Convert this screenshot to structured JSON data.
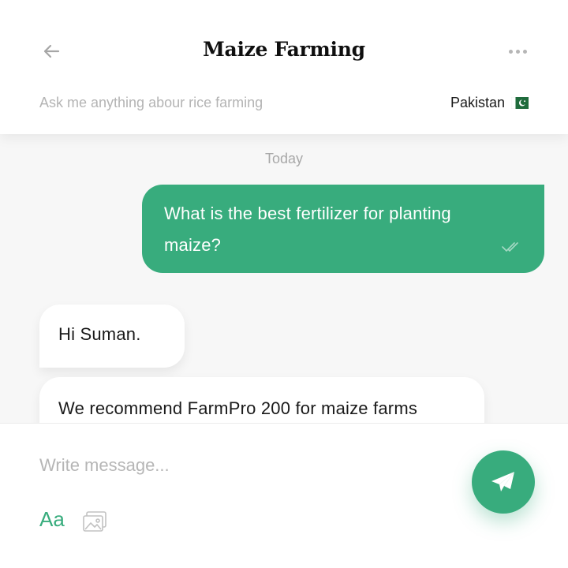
{
  "header": {
    "title": "Maize Farming",
    "subtitle": "Ask me anything abour rice farming",
    "country": "Pakistan"
  },
  "chat": {
    "date_separator": "Today",
    "messages": [
      {
        "direction": "outgoing",
        "text": "What is the best fertilizer for planting maize?",
        "status": "read"
      },
      {
        "direction": "incoming",
        "text": "Hi Suman."
      },
      {
        "direction": "incoming",
        "text": "We recommend FarmPro 200 for maize farms"
      }
    ]
  },
  "composer": {
    "placeholder": "Write message...",
    "format_label": "Aa"
  },
  "icons": {
    "back": "arrow-left-icon",
    "more": "more-horizontal-icon",
    "flag": "pakistan-flag-icon",
    "read": "double-check-icon",
    "image": "image-icon",
    "send": "paper-plane-icon"
  },
  "colors": {
    "accent": "#38ac7d",
    "background": "#f7f7f7",
    "surface": "#ffffff",
    "muted_text": "#b4b4b4"
  }
}
